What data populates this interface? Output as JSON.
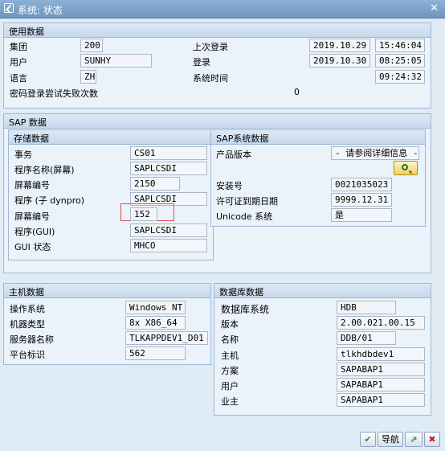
{
  "window": {
    "title": "系统: 状态",
    "close_symbol": "✕"
  },
  "usage": {
    "header": "使用数据",
    "client_label": "集团",
    "client_value": "200",
    "user_label": "用户",
    "user_value": "SUNHY",
    "lang_label": "语言",
    "lang_value": "ZH",
    "pwd_fail_label": "密码登录尝试失败次数",
    "pwd_fail_value": "0",
    "last_logon_label": "上次登录",
    "last_logon_date": "2019.10.29",
    "last_logon_time": "15:46:04",
    "logon_label": "登录",
    "logon_date": "2019.10.30",
    "logon_time": "08:25:05",
    "systime_label": "系统时间",
    "systime_value": "09:24:32"
  },
  "sap": {
    "header": "SAP 数据",
    "storage": {
      "header": "存储数据",
      "tx_label": "事务",
      "tx_value": "CS01",
      "prog_screen_label": "程序名称(屏幕)",
      "prog_screen_value": "SAPLCSDI",
      "screen_no_label": "屏幕编号",
      "screen_no_value": "2150",
      "prog_sub_label": "程序 (子 dynpro)",
      "prog_sub_value": "SAPLCSDI",
      "screen_no2_label": "屏幕编号",
      "screen_no2_value": "152",
      "prog_gui_label": "程序(GUI)",
      "prog_gui_value": "SAPLCSDI",
      "gui_status_label": "GUI 状态",
      "gui_status_value": "MHCO"
    },
    "system": {
      "header": "SAP系统数据",
      "product_label": "产品版本",
      "product_value": "- 请参阅详细信息 -",
      "install_label": "安装号",
      "install_value": "0021035023",
      "license_label": "许可证到期日期",
      "license_value": "9999.12.31",
      "unicode_label": "Unicode 系统",
      "unicode_value": "是"
    }
  },
  "host": {
    "header": "主机数据",
    "os_label": "操作系统",
    "os_value": "Windows NT",
    "machine_label": "机器类型",
    "machine_value": "8x X86_64",
    "server_label": "服务器名称",
    "server_value": "TLKAPPDEV1_D01",
    "platform_label": "平台标识",
    "platform_value": "562"
  },
  "db": {
    "header": "数据库数据",
    "system_label": "数据库系统",
    "system_value": "HDB",
    "version_label": "版本",
    "version_value": "2.00.021.00.15",
    "name_label": "名称",
    "name_value": "DDB/01",
    "host_label": "主机",
    "host_value": "tlkhdbdev1",
    "schema_label": "方案",
    "schema_value": "SAPABAP1",
    "user_label": "用户",
    "user_value": "SAPABAP1",
    "owner_label": "业主",
    "owner_value": "SAPABAP1"
  },
  "footer": {
    "nav_label": "导航",
    "ok_symbol": "✔",
    "cancel_symbol": "✖",
    "other_symbol": "⇗"
  }
}
